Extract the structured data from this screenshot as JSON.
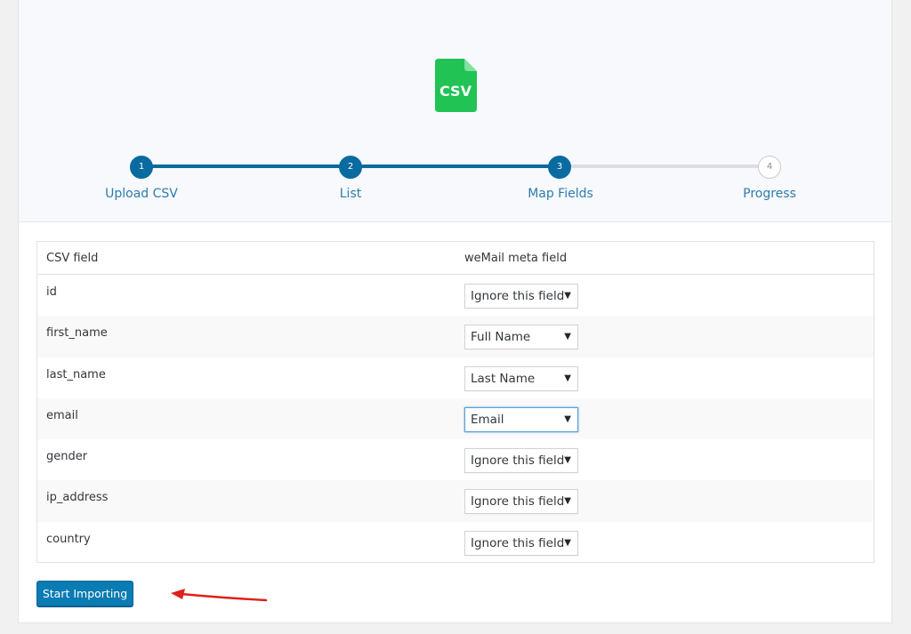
{
  "icon": {
    "name": "csv-file-icon",
    "text": "CSV",
    "color": "#21c354"
  },
  "steps": [
    {
      "number": "1",
      "label": "Upload CSV",
      "state": "done"
    },
    {
      "number": "2",
      "label": "List",
      "state": "done"
    },
    {
      "number": "3",
      "label": "Map Fields",
      "state": "done"
    },
    {
      "number": "4",
      "label": "Progress",
      "state": "todo"
    }
  ],
  "table": {
    "headers": {
      "csv": "CSV field",
      "meta": "weMail meta field"
    },
    "rows": [
      {
        "field": "id",
        "mapping": "Ignore this field"
      },
      {
        "field": "first_name",
        "mapping": "Full Name"
      },
      {
        "field": "last_name",
        "mapping": "Last Name"
      },
      {
        "field": "email",
        "mapping": "Email"
      },
      {
        "field": "gender",
        "mapping": "Ignore this field"
      },
      {
        "field": "ip_address",
        "mapping": "Ignore this field"
      },
      {
        "field": "country",
        "mapping": "Ignore this field"
      }
    ]
  },
  "button": {
    "label": "Start Importing"
  },
  "colors": {
    "primary": "#0a6ba0",
    "annotation_arrow": "#e0201b"
  }
}
